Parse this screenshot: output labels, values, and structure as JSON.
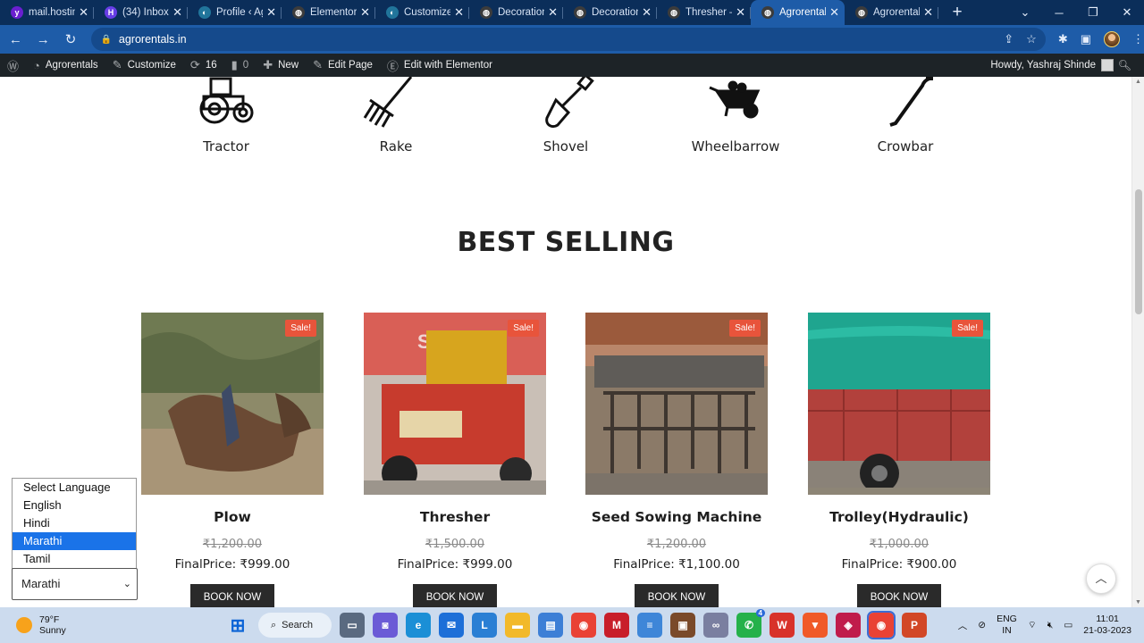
{
  "browser": {
    "tabs": [
      {
        "title": "mail.hostinger",
        "fav_color": "#6a1fd0",
        "fav_glyph": "y"
      },
      {
        "title": "(34) Inbox - ",
        "fav_color": "#673de6",
        "fav_glyph": "H"
      },
      {
        "title": "Profile ‹ Agr",
        "fav_color": "#21759b",
        "fav_glyph": "◐"
      },
      {
        "title": "Elementor | ",
        "fav_color": "#3c3c3c",
        "fav_glyph": "◍"
      },
      {
        "title": "Customize: ",
        "fav_color": "#21759b",
        "fav_glyph": "◐"
      },
      {
        "title": "Decoration ",
        "fav_color": "#3c3c3c",
        "fav_glyph": "◍"
      },
      {
        "title": "Decoration ",
        "fav_color": "#3c3c3c",
        "fav_glyph": "◍"
      },
      {
        "title": "Thresher – A",
        "fav_color": "#3c3c3c",
        "fav_glyph": "◍"
      },
      {
        "title": "Agrorentals",
        "fav_color": "#3c3c3c",
        "fav_glyph": "◍"
      },
      {
        "title": "Agrorentals",
        "fav_color": "#3c3c3c",
        "fav_glyph": "◍"
      }
    ],
    "active_tab": 8,
    "url": "agrorentals.in"
  },
  "adminbar": {
    "site": "Agrorentals",
    "customize": "Customize",
    "updates": "16",
    "comments": "0",
    "new": "New",
    "edit_page": "Edit Page",
    "edit_elementor": "Edit with Elementor",
    "greeting": "Howdy, Yashraj Shinde"
  },
  "tools": [
    {
      "label": "Tractor",
      "icon": "tractor-icon"
    },
    {
      "label": "Rake",
      "icon": "rake-icon"
    },
    {
      "label": "Shovel",
      "icon": "shovel-icon"
    },
    {
      "label": "Wheelbarrow",
      "icon": "wheelbarrow-icon"
    },
    {
      "label": "Crowbar",
      "icon": "crowbar-icon"
    }
  ],
  "section_title": "BEST SELLING",
  "products": [
    {
      "name": "Plow",
      "badge": "Sale!",
      "old_price": "₹1,200.00",
      "final_price": "FinalPrice:  ₹999.00",
      "button": "BOOK NOW"
    },
    {
      "name": "Thresher",
      "badge": "Sale!",
      "old_price": "₹1,500.00",
      "final_price": "FinalPrice:  ₹999.00",
      "button": "BOOK NOW"
    },
    {
      "name": "Seed Sowing Machine",
      "badge": "Sale!",
      "old_price": "₹1,200.00",
      "final_price": "FinalPrice:  ₹1,100.00",
      "button": "BOOK NOW"
    },
    {
      "name": "Trolley(Hydraulic)",
      "badge": "Sale!",
      "old_price": "₹1,000.00",
      "final_price": "FinalPrice:  ₹900.00",
      "button": "BOOK NOW"
    }
  ],
  "language": {
    "options": [
      "Select Language",
      "English",
      "Hindi",
      "Marathi",
      "Tamil"
    ],
    "highlighted": 3,
    "selected": "Marathi"
  },
  "taskbar": {
    "temp": "79°F",
    "condition": "Sunny",
    "search": "Search",
    "lang_top": "ENG",
    "lang_bottom": "IN",
    "time": "11:01",
    "date": "21-03-2023",
    "whatsapp_badge": "4"
  }
}
